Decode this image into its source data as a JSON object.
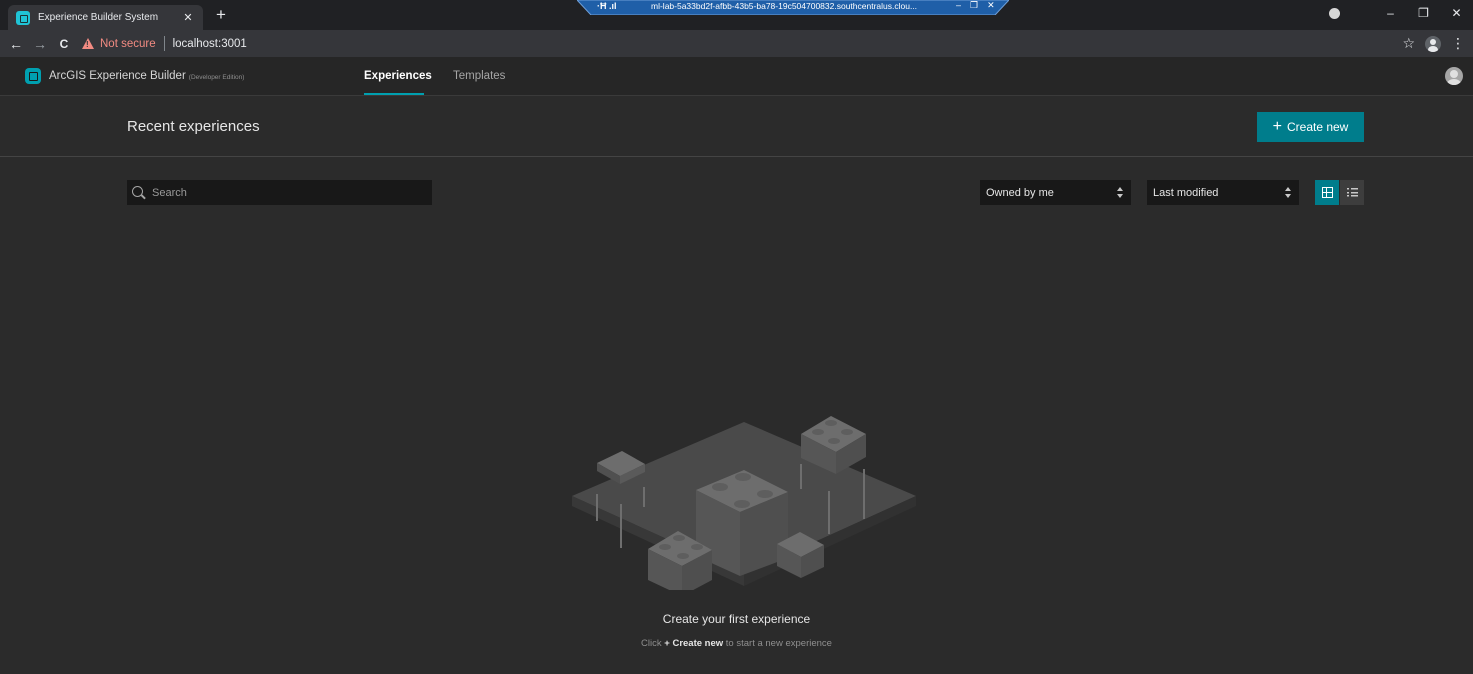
{
  "browser": {
    "tab_title": "Experience Builder System",
    "tab_close": "✕",
    "new_tab": "+",
    "url": "localhost:3001",
    "security_label": "Not secure",
    "remote_session": {
      "signal": "·Ħ .ıl",
      "host": "ml-lab-5a33bd2f-afbb-43b5-ba78-19c504700832.southcentralus.clou...",
      "minimize": "‒",
      "restore": "❐",
      "close": "✕"
    },
    "window_controls": {
      "minimize": "–",
      "maximize": "❐",
      "close": "✕"
    },
    "icons": {
      "back": "←",
      "forward": "→",
      "reload": "C",
      "bookmark": "☆",
      "menu": "⋮"
    }
  },
  "app": {
    "name": "ArcGIS Experience Builder",
    "edition": "(Developer Edition)",
    "nav": [
      "Experiences",
      "Templates"
    ],
    "active_nav": "Experiences",
    "accent_color": "#007d8c"
  },
  "main": {
    "title": "Recent experiences",
    "create_button": "Create new",
    "search_placeholder": "Search",
    "filter_owner": "Owned by me",
    "sort_by": "Last modified",
    "empty_state": {
      "title": "Create your first experience",
      "hint_prefix": "Click",
      "hint_action": "+ Create new",
      "hint_suffix": "to start a new experience"
    }
  }
}
